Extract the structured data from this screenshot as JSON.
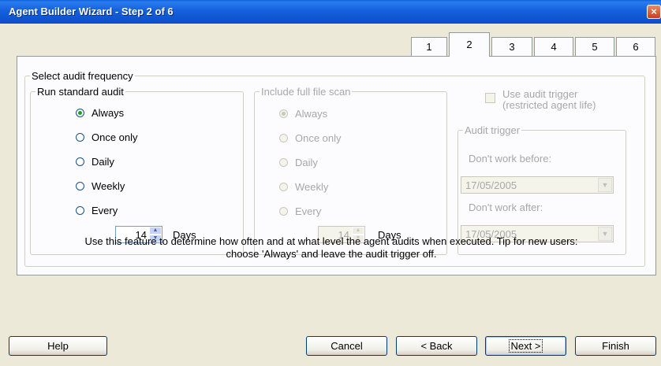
{
  "window": {
    "title": "Agent Builder Wizard - Step 2 of 6",
    "close_glyph": "×"
  },
  "tabs": [
    "1",
    "2",
    "3",
    "4",
    "5",
    "6"
  ],
  "active_tab": "2",
  "frequency_group": {
    "label": "Select audit frequency"
  },
  "standard_audit": {
    "label": "Run standard audit",
    "options": [
      "Always",
      "Once only",
      "Daily",
      "Weekly",
      "Every"
    ],
    "selected": "Always",
    "every_value": "14",
    "every_unit": "Days"
  },
  "full_scan": {
    "label": "Include full file scan",
    "enabled": false,
    "options": [
      "Always",
      "Once only",
      "Daily",
      "Weekly",
      "Every"
    ],
    "selected": "Always",
    "every_value": "14",
    "every_unit": "Days"
  },
  "use_trigger": {
    "line1": "Use audit trigger",
    "line2": "(restricted agent life)",
    "checked": false,
    "enabled": false
  },
  "audit_trigger": {
    "label": "Audit trigger",
    "before_label": "Don't work before:",
    "before_value": "17/05/2005",
    "after_label": "Don't work after:",
    "after_value": "17/05/2005"
  },
  "hint": {
    "line1": "Use this feature to determine how often and at what level the agent audits when executed. Tip for new users:",
    "line2": "choose 'Always' and leave the audit trigger off."
  },
  "buttons": {
    "help": "Help",
    "cancel": "Cancel",
    "back": "< Back",
    "next": "Next >",
    "finish": "Finish"
  }
}
